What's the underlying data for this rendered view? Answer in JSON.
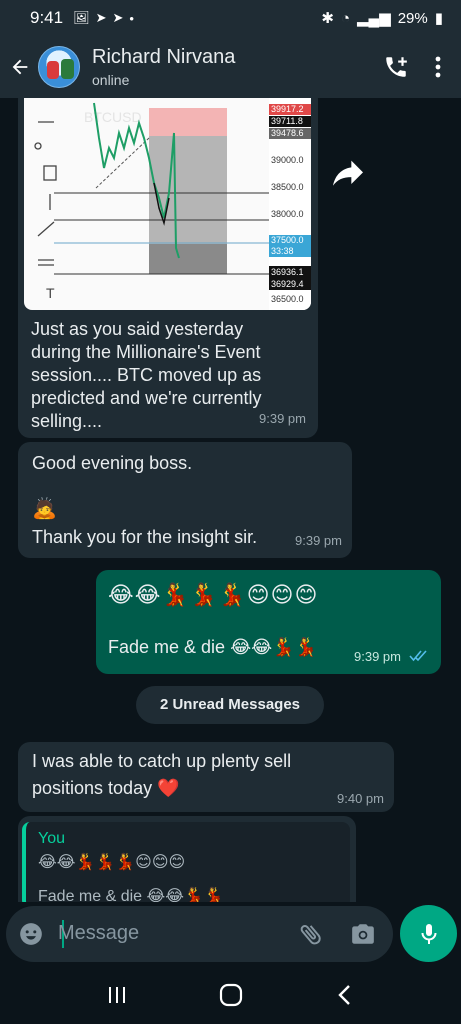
{
  "status_bar": {
    "time": "9:41",
    "battery": "29%"
  },
  "header": {
    "name": "Richard Nirvana",
    "status": "online"
  },
  "messages": [
    {
      "type": "incoming_image",
      "chart_labels": [
        "39917.2",
        "39711.8",
        "39478.6",
        "39000.0",
        "38500.0",
        "38000.0",
        "37500.0",
        "33:38",
        "36936.1",
        "36929.4",
        "36500.0"
      ],
      "text": "Just as you said yesterday during the Millionaire's Event session.... BTC moved up as predicted and we're currently selling....",
      "time": "9:39 pm"
    },
    {
      "type": "incoming",
      "line1": "Good evening boss.",
      "emoji": "🙇",
      "line2": "Thank you for the insight sir.",
      "time": "9:39 pm"
    },
    {
      "type": "outgoing",
      "emoji_line": "😂😂💃💃💃😊😊😊",
      "text": "Fade me & die 😂😂💃💃",
      "time": "9:39 pm"
    }
  ],
  "unread_divider": "2 Unread Messages",
  "unread_messages": [
    {
      "type": "incoming",
      "text": "I was able to catch up plenty sell positions today ❤️",
      "time": "9:40 pm"
    },
    {
      "type": "reply",
      "quoted_author": "You",
      "quoted_line1": "😂😂💃💃💃😊😊😊",
      "quoted_line2": "Fade me & die 😂😂💃💃"
    }
  ],
  "input": {
    "placeholder": "Message"
  },
  "colors": {
    "accent": "#00a884",
    "outgoing_bubble": "#005c4b",
    "incoming_bubble": "#1f2c34"
  }
}
